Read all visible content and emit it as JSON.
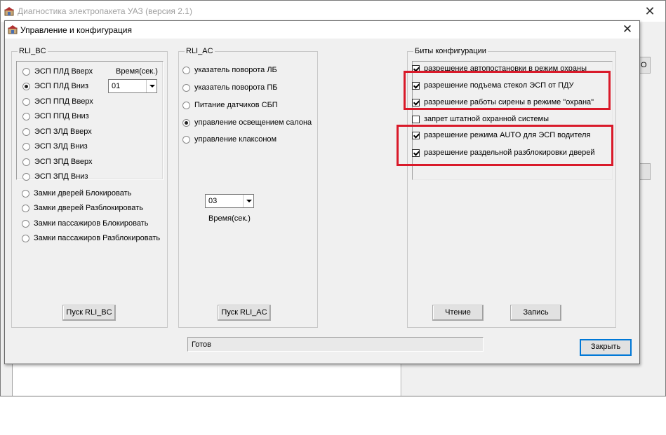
{
  "main_window": {
    "title": "Диагностика электропакета УАЗ (версия 2.1)",
    "close_label": "✕",
    "partial_button_label": "О"
  },
  "dialog": {
    "title": "Управление и конфигурация",
    "close_label": "✕"
  },
  "rli_bc": {
    "legend": "RLI_BC",
    "options": [
      {
        "label": "ЭСП ПЛД Вверх",
        "checked": false
      },
      {
        "label": "ЭСП ПЛД Вниз",
        "checked": true
      },
      {
        "label": "ЭСП ППД Вверх",
        "checked": false
      },
      {
        "label": "ЭСП ППД Вниз",
        "checked": false
      },
      {
        "label": "ЭСП ЗЛД Вверх",
        "checked": false
      },
      {
        "label": "ЭСП ЗЛД Вниз",
        "checked": false
      },
      {
        "label": "ЭСП ЗПД Вверх",
        "checked": false
      },
      {
        "label": "ЭСП ЗПД Вниз",
        "checked": false
      }
    ],
    "time_label": "Время(сек.)",
    "time_value": "01",
    "lock_options": [
      {
        "label": "Замки дверей Блокировать",
        "checked": false
      },
      {
        "label": "Замки дверей Разблокировать",
        "checked": false
      },
      {
        "label": "Замки пассажиров Блокировать",
        "checked": false
      },
      {
        "label": "Замки пассажиров Разблокировать",
        "checked": false
      }
    ],
    "start_button": "Пуск RLI_BC"
  },
  "rli_ac": {
    "legend": "RLI_AC",
    "options": [
      {
        "label": "указатель поворота ЛБ",
        "checked": false
      },
      {
        "label": "указатель поворота ПБ",
        "checked": false
      },
      {
        "label": "Питание датчиков СБП",
        "checked": false
      },
      {
        "label": "управление освещением салона",
        "checked": true
      },
      {
        "label": "управление клаксоном",
        "checked": false
      }
    ],
    "time_value": "03",
    "time_label": "Время(сек.)",
    "start_button": "Пуск RLI_AC"
  },
  "config_bits": {
    "legend": "Биты конфигурации",
    "items": [
      {
        "label": "разрешение автопостановки в режим охраны",
        "checked": true
      },
      {
        "label": "разрешение подъема стекол ЭСП от ПДУ",
        "checked": true
      },
      {
        "label": "разрешение работы сирены в режиме \"охрана\"",
        "checked": true
      },
      {
        "label": "запрет штатной охранной системы",
        "checked": false
      },
      {
        "label": "разрешение режима AUTO для ЭСП водителя",
        "checked": true
      },
      {
        "label": "разрешение раздельной разблокировки дверей",
        "checked": true
      }
    ],
    "read_button": "Чтение",
    "write_button": "Запись"
  },
  "status_text": "Готов",
  "close_button": "Закрыть",
  "colors": {
    "highlight": "#d91a2a",
    "dialog_bg": "#f0f0f0",
    "default_button_border": "#0078d7"
  }
}
